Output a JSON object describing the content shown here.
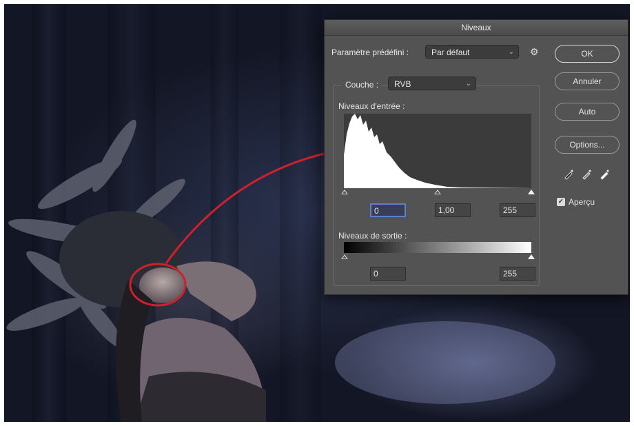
{
  "dialog": {
    "title": "Niveaux",
    "preset_label": "Paramètre prédéfini :",
    "preset_value": "Par défaut",
    "channel_label": "Couche :",
    "channel_value": "RVB",
    "input_levels_label": "Niveaux d'entrée :",
    "input_black": "0",
    "input_gamma": "1,00",
    "input_white": "255",
    "output_levels_label": "Niveaux de sortie :",
    "output_black": "0",
    "output_white": "255",
    "buttons": {
      "ok": "OK",
      "cancel": "Annuler",
      "auto": "Auto",
      "options": "Options..."
    },
    "preview_label": "Aperçu",
    "preview_checked": true
  },
  "icons": {
    "preset_menu": "gear-icon",
    "chevron": "chevron-down-icon",
    "eyedroppers": [
      "black-eyedropper-icon",
      "gray-eyedropper-icon",
      "white-eyedropper-icon"
    ]
  },
  "colors": {
    "dialog_bg": "#535353",
    "annotation": "#d0202a",
    "active_field": "#5b7fd3"
  }
}
